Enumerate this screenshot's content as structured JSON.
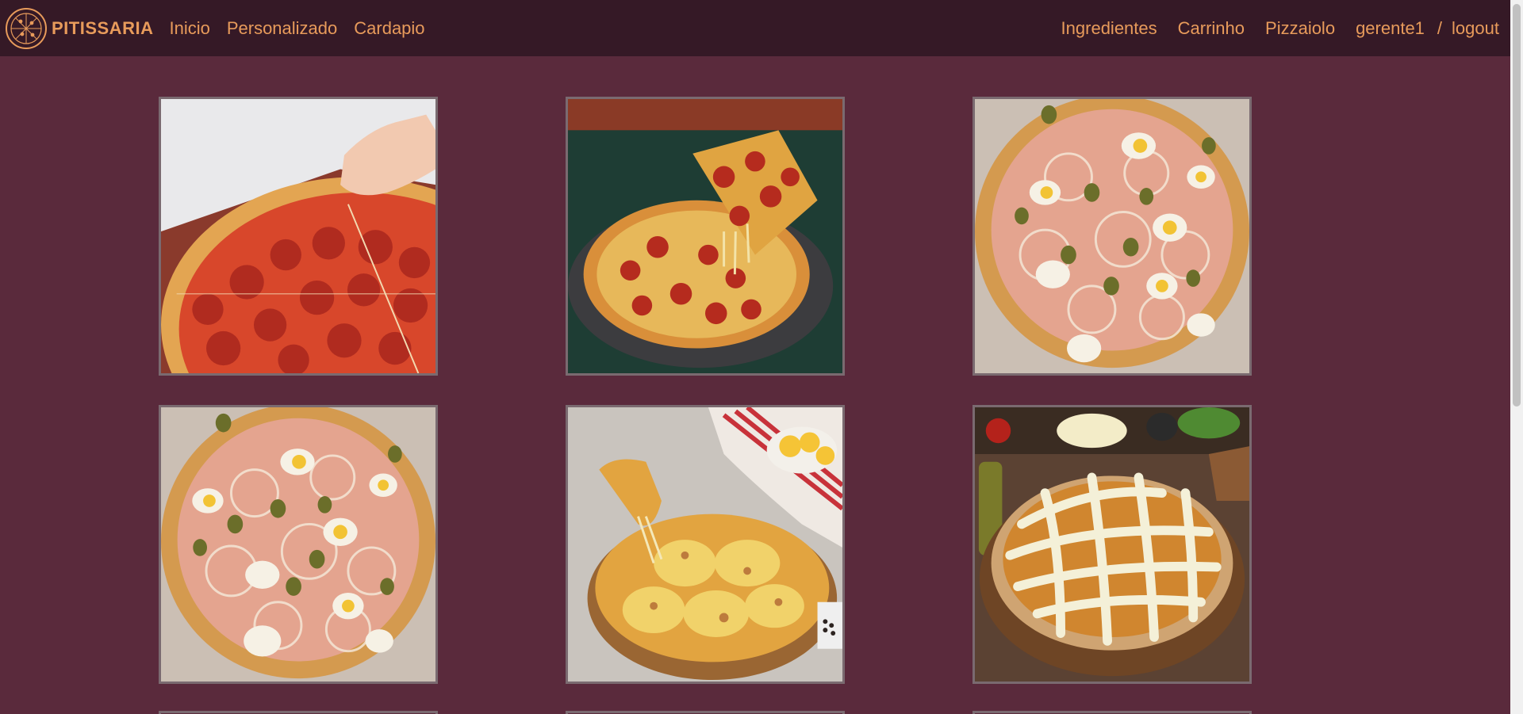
{
  "brand": {
    "name": "PITISSARIA"
  },
  "nav": {
    "left": [
      {
        "label": "Inicio"
      },
      {
        "label": "Personalizado"
      },
      {
        "label": "Cardapio"
      }
    ],
    "right": [
      {
        "label": "Ingredientes"
      },
      {
        "label": "Carrinho"
      },
      {
        "label": "Pizzaiolo"
      }
    ],
    "user": "gerente1",
    "separator": "/",
    "logout": "logout"
  },
  "products": [
    {
      "image": "pepperoni-pizza-box-photo"
    },
    {
      "image": "pepperoni-pizza-slice-lift-photo"
    },
    {
      "image": "portuguesa-pizza-photo"
    },
    {
      "image": "portuguesa-pizza-photo"
    },
    {
      "image": "cheese-pizza-slice-pull-photo"
    },
    {
      "image": "frango-catupiry-pizza-photo"
    }
  ],
  "colors": {
    "background": "#5a2a3c",
    "navbar": "#351926",
    "accent": "#e89b5b",
    "card_border": "#7a6a70"
  }
}
